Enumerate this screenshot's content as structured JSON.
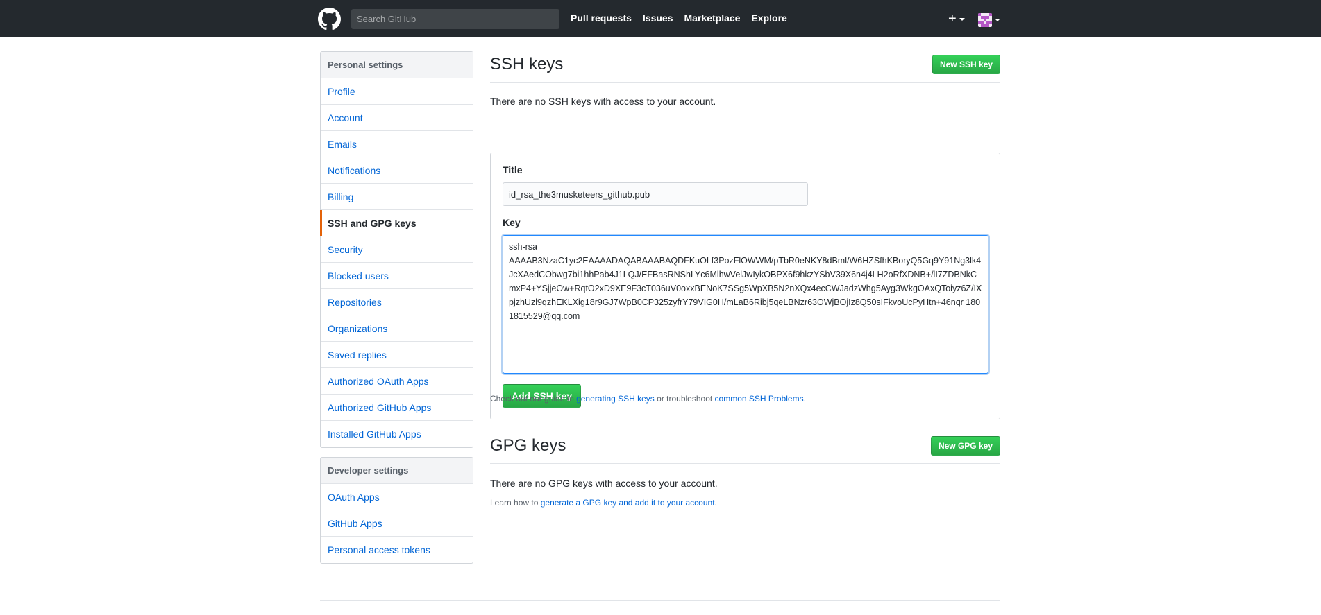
{
  "header": {
    "search_placeholder": "Search GitHub",
    "nav": [
      "Pull requests",
      "Issues",
      "Marketplace",
      "Explore"
    ],
    "plus_label": "+",
    "logo_icon": "github-octocat-icon",
    "avatar_icon": "identicon-avatar"
  },
  "sidebar": {
    "personal_heading": "Personal settings",
    "personal_items": [
      "Profile",
      "Account",
      "Emails",
      "Notifications",
      "Billing",
      "SSH and GPG keys",
      "Security",
      "Blocked users",
      "Repositories",
      "Organizations",
      "Saved replies",
      "Authorized OAuth Apps",
      "Authorized GitHub Apps",
      "Installed GitHub Apps"
    ],
    "selected_item": "SSH and GPG keys",
    "developer_heading": "Developer settings",
    "developer_items": [
      "OAuth Apps",
      "GitHub Apps",
      "Personal access tokens"
    ]
  },
  "ssh": {
    "heading": "SSH keys",
    "new_button": "New SSH key",
    "empty_text": "There are no SSH keys with access to your account.",
    "title_label": "Title",
    "title_value": "id_rsa_the3musketeers_github.pub",
    "key_label": "Key",
    "key_value": "ssh-rsa\nAAAAB3NzaC1yc2EAAAADAQABAAABAQDFKuOLf3PozFlOWWM/pTbR0eNKY8dBml/W6HZSfhKBoryQ5Gq9Y91Ng3lk4JcXAedCObwg7bi1hhPab4J1LQJ/EFBasRNShLYc6MlhwVelJwIykOBPX6f9hkzYSbV39X6n4j4LH2oRfXDNB+/lI7ZDBNkCmxP4+YSjjeOw+RqtO2xD9XE9F3cT036uV0oxxBENoK7SSg5WpXB5N2nXQx4ecCWJadzWhg5Ayg3WkgOAxQToiyz6Z/IXpjzhUzl9qzhEKLXig18r9GJ7WpB0CP325zyfrY79VIG0H/mLaB6Ribj5qeLBNzr63OWjBOjIz8Q50sIFkvoUcPyHtn+46nqr 1801815529@qq.com",
    "add_button": "Add SSH key",
    "guide_prefix": "Check out our guide to ",
    "guide_link1": "generating SSH keys",
    "guide_middle": " or troubleshoot ",
    "guide_link2": "common SSH Problems",
    "guide_suffix": "."
  },
  "gpg": {
    "heading": "GPG keys",
    "new_button": "New GPG key",
    "empty_text": "There are no GPG keys with access to your account.",
    "learn_prefix": "Learn how to ",
    "learn_link": "generate a GPG key and add it to your account",
    "learn_suffix": "."
  },
  "colors": {
    "header_bg": "#24292e",
    "link": "#0366d6",
    "green": "#28a745",
    "selected_marker": "#e36209"
  }
}
